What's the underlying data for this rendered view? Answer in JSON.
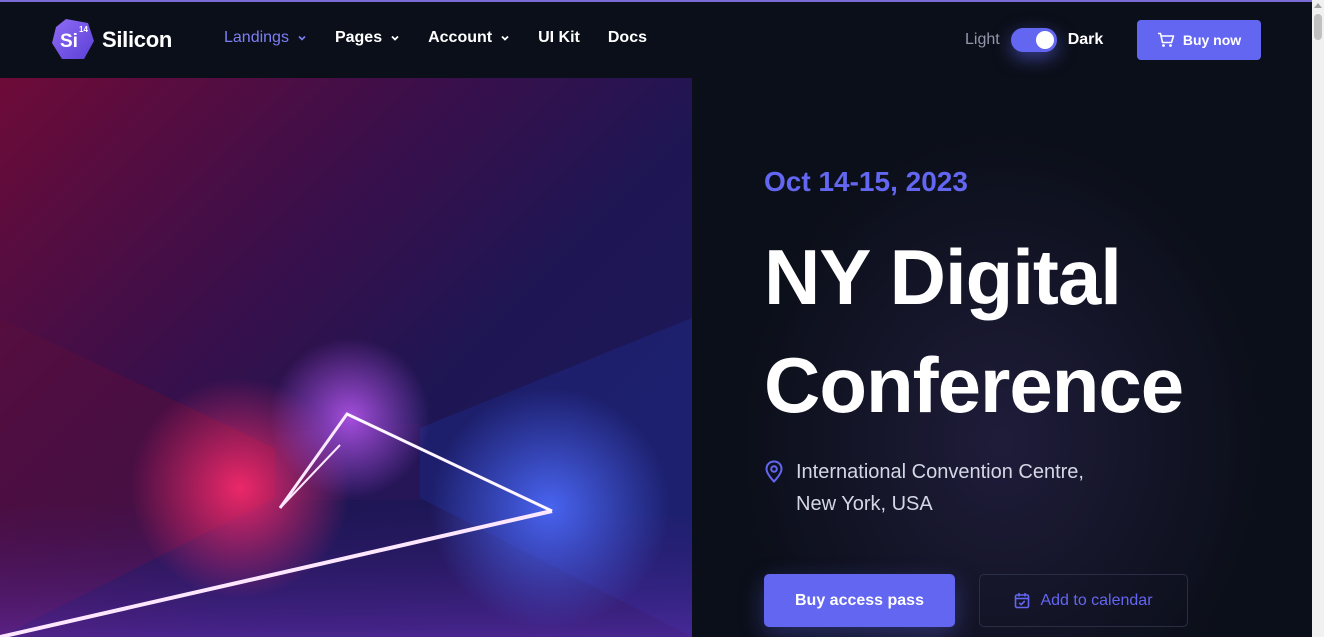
{
  "header": {
    "brand_name": "Silicon",
    "logo_text": "Si",
    "logo_badge": "14",
    "nav": [
      {
        "label": "Landings",
        "dropdown": true,
        "active": true
      },
      {
        "label": "Pages",
        "dropdown": true,
        "active": false
      },
      {
        "label": "Account",
        "dropdown": true,
        "active": false
      },
      {
        "label": "UI Kit",
        "dropdown": false,
        "active": false
      },
      {
        "label": "Docs",
        "dropdown": false,
        "active": false
      }
    ],
    "theme_light_label": "Light",
    "theme_dark_label": "Dark",
    "theme_mode": "dark",
    "buy_label": "Buy now"
  },
  "hero": {
    "date": "Oct 14-15, 2023",
    "title_line1": "NY Digital",
    "title_line2": "Conference",
    "location_line1": "International Convention Centre,",
    "location_line2": "New York, USA",
    "primary_button": "Buy access pass",
    "secondary_button": "Add to calendar"
  },
  "colors": {
    "accent": "#6366f1",
    "background": "#0b0f19",
    "text_muted": "#9397ad"
  },
  "icons": {
    "cart": "cart-icon",
    "location": "map-pin-icon",
    "calendar": "calendar-check-icon",
    "chevron": "chevron-down-icon"
  }
}
